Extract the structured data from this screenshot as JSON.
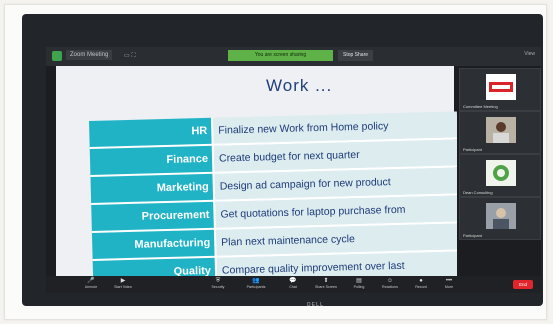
{
  "topbar": {
    "window_title": "Zoom Meeting",
    "sharing_banner": "You are screen sharing",
    "stop_share_label": "Stop Share",
    "view_label": "View"
  },
  "slide": {
    "title": "Work ...",
    "rows": [
      {
        "dept": "HR",
        "task": "Finalize new Work from Home policy"
      },
      {
        "dept": "Finance",
        "task": "Create budget for next quarter"
      },
      {
        "dept": "Marketing",
        "task": "Design ad campaign for new product"
      },
      {
        "dept": "Procurement",
        "task": "Get quotations for laptop purchase from"
      },
      {
        "dept": "Manufacturing",
        "task": "Plan next maintenance cycle"
      },
      {
        "dept": "Quality",
        "task": "Compare quality improvement over last"
      }
    ]
  },
  "participants": [
    {
      "name": "Committee Meeting",
      "kind": "logo"
    },
    {
      "name": "Participant",
      "kind": "person"
    },
    {
      "name": "Dean Consulting",
      "kind": "logo"
    },
    {
      "name": "Participant",
      "kind": "person"
    }
  ],
  "toolbar": {
    "items": [
      {
        "icon": "microphone-icon",
        "glyph": "🎤",
        "label": "Unmute"
      },
      {
        "icon": "video-icon",
        "glyph": "▶",
        "label": "Start Video"
      },
      {
        "icon": "security-icon",
        "glyph": "⛨",
        "label": "Security"
      },
      {
        "icon": "participants-icon",
        "glyph": "👥",
        "label": "Participants"
      },
      {
        "icon": "chat-icon",
        "glyph": "💬",
        "label": "Chat"
      },
      {
        "icon": "share-screen-icon",
        "glyph": "⬆",
        "label": "Share Screen"
      },
      {
        "icon": "polling-icon",
        "glyph": "▤",
        "label": "Polling"
      },
      {
        "icon": "reactions-icon",
        "glyph": "☺",
        "label": "Reactions"
      },
      {
        "icon": "record-icon",
        "glyph": "●",
        "label": "Record"
      },
      {
        "icon": "more-icon",
        "glyph": "•••",
        "label": "More"
      }
    ],
    "end_label": "End"
  },
  "monitor": {
    "brand": "DELL"
  },
  "colors": {
    "table_header": "#20b3c5",
    "table_cell": "#dcecef",
    "title": "#22407a",
    "share_banner": "#5fb247",
    "end_button": "#e0262b"
  }
}
